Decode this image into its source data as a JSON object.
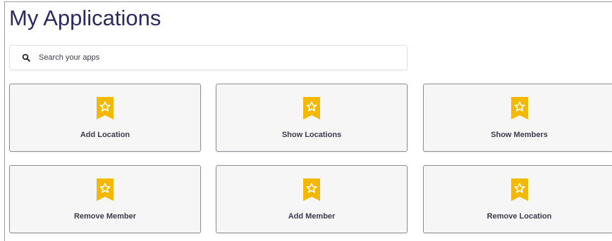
{
  "header": {
    "title": "My Applications"
  },
  "search": {
    "placeholder": "Search your apps",
    "value": ""
  },
  "theme": {
    "title_color": "#2b2a5e",
    "badge_color": "#f5b800",
    "tile_background": "#f6f6f7",
    "tile_border": "#8c8c96"
  },
  "apps": [
    {
      "label": "Add Location",
      "icon": "star-badge-icon"
    },
    {
      "label": "Show Locations",
      "icon": "star-badge-icon"
    },
    {
      "label": "Show Members",
      "icon": "star-badge-icon"
    },
    {
      "label": "Remove Member",
      "icon": "star-badge-icon"
    },
    {
      "label": "Add Member",
      "icon": "star-badge-icon"
    },
    {
      "label": "Remove Location",
      "icon": "star-badge-icon"
    }
  ]
}
